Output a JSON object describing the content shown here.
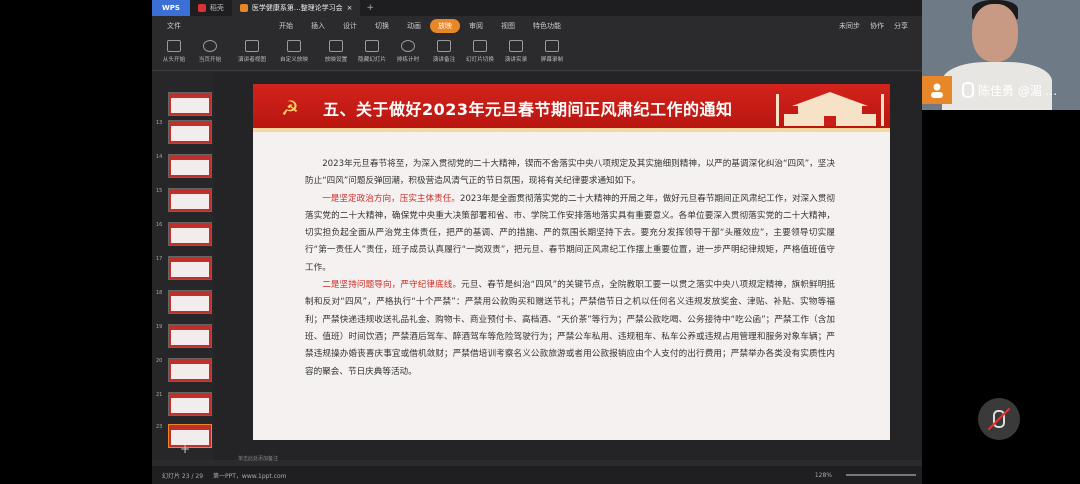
{
  "titlebar": {
    "app": "WPS",
    "tabs": [
      {
        "label": "稻壳",
        "active": false
      },
      {
        "label": "医学健康系第...整理论学习会",
        "active": true
      }
    ]
  },
  "menu": {
    "file": "文件",
    "items": [
      "开始",
      "插入",
      "设计",
      "切换",
      "动画",
      "放映",
      "审阅",
      "视图",
      "特色功能"
    ],
    "active": "放映",
    "right": [
      "未同步",
      "协作",
      "分享"
    ]
  },
  "ribbon": {
    "tools": [
      "从头开始",
      "当页开始",
      "演讲者视图",
      "自定义放映",
      "放映设置",
      "隐藏幻灯片",
      "排练计时",
      "演讲备注",
      "幻灯片切换",
      "演讲实录",
      "屏幕录制"
    ]
  },
  "thumbnails": {
    "numbers": [
      "13",
      "14",
      "15",
      "16",
      "17",
      "18",
      "19",
      "20",
      "21",
      "22",
      "23"
    ],
    "active": "23"
  },
  "slide": {
    "title": "五、关于做好2023年元旦春节期间正风肃纪工作的通知",
    "p1": "2023年元旦春节将至，为深入贯彻党的二十大精神，锲而不舍落实中央八项规定及其实施细则精神，以严的基调深化纠治“四风”，坚决防止“四风”问题反弹回潮，积极营造风清气正的节日氛围，现将有关纪律要求通知如下。",
    "p2_hl": "一是坚定政治方向，压实主体责任。",
    "p2": "2023年是全面贯彻落实党的二十大精神的开局之年，做好元旦春节期间正风肃纪工作，对深入贯彻落实党的二十大精神，确保党中央重大决策部署和省、市、学院工作安排落地落实具有重要意义。各单位要深入贯彻落实党的二十大精神，切实担负起全面从严治党主体责任，把严的基调、严的措施、严的氛围长期坚持下去。要充分发挥领导干部“头雁效应”，主要领导切实履行“第一责任人”责任，班子成员认真履行“一岗双责”，把元旦、春节期间正风肃纪工作摆上重要位置，进一步严明纪律规矩，严格值班值守工作。",
    "p3_hl": "二是坚持问题导向，严守纪律底线。",
    "p3": "元旦、春节是纠治“四风”的关键节点，全院教职工要一以贯之落实中央八项规定精神，旗帜鲜明抵制和反对“四风”，严格执行“十个严禁”：严禁用公款购买和赠送节礼；严禁借节日之机以任何名义违规发放奖金、津贴、补贴、实物等福利；严禁快递违规收送礼品礼金、购物卡、商业预付卡、高档酒、“天价茶”等行为；严禁公款吃喝、公务接待中“吃公函”；严禁工作（含加班、值班）时间饮酒；严禁酒后驾车、醉酒驾车等危险驾驶行为；严禁公车私用、违规租车、私车公养或违规占用管理和服务对象车辆；严禁违规操办婚丧喜庆事宜或借机敛财；严禁借培训考察名义公款旅游或者用公款报销应由个人支付的出行费用；严禁举办各类没有实质性内容的聚会、节日庆典等活动。"
  },
  "note": "单击此处添加备注",
  "status": {
    "slide_count": "幻灯片 23 / 29",
    "theme": "第一PPT，www.1ppt.com",
    "zoom": "128%"
  },
  "webcam": {
    "name": "陈佳勇 @湄 ..."
  },
  "colors": {
    "banner": "#c81d18",
    "accent": "#e8862a",
    "highlight": "#cc2a22"
  }
}
